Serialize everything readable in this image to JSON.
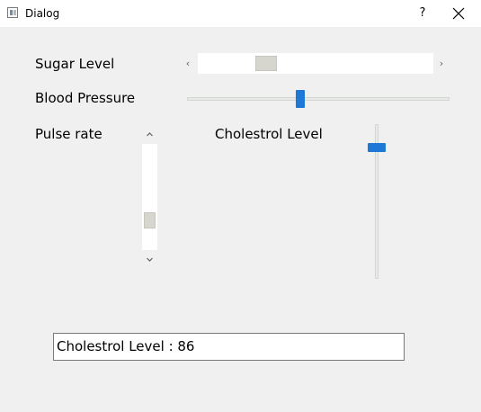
{
  "window": {
    "title": "Dialog",
    "help_label": "?"
  },
  "controls": {
    "sugar_level": {
      "label": "Sugar Level",
      "value_fraction": 0.27
    },
    "blood_pressure": {
      "label": "Blood Pressure",
      "value_fraction": 0.43
    },
    "pulse_rate": {
      "label": "Pulse rate",
      "value_fraction": 0.76
    },
    "cholestrol_level": {
      "label": "Cholestrol Level",
      "value": 86,
      "max": 99
    }
  },
  "output": {
    "text": "Cholestrol Level : 86"
  },
  "colors": {
    "accent": "#1e79d6",
    "window_background": "#f0f0f0",
    "scroll_thumb": "#d6d6ce"
  },
  "icons": {
    "left_arrow": "chevron-left-icon",
    "right_arrow": "chevron-right-icon",
    "up_arrow": "chevron-up-icon",
    "down_arrow": "chevron-down-icon",
    "close": "close-icon"
  }
}
